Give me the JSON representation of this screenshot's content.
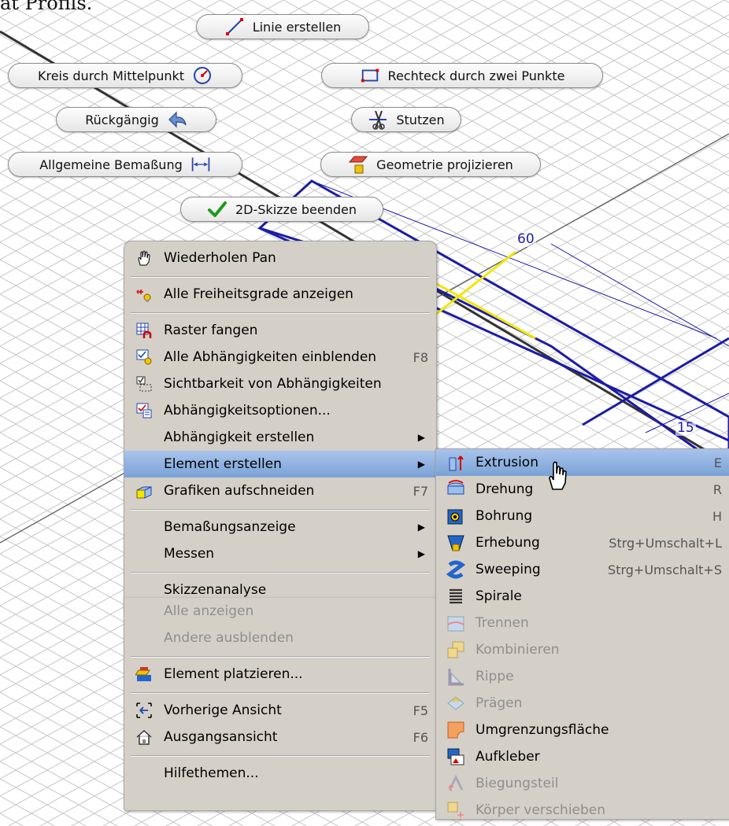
{
  "caption": "at Profils.",
  "dimensions": {
    "top": "60",
    "side": "15"
  },
  "marking_buttons": {
    "line": "Linie erstellen",
    "circle": "Kreis durch Mittelpunkt",
    "rectangle": "Rechteck durch zwei Punkte",
    "undo": "Rückgängig",
    "trim": "Stutzen",
    "dimension": "Allgemeine Bemaßung",
    "project": "Geometrie projizieren",
    "finish": "2D-Skizze beenden"
  },
  "context_menu": {
    "items": [
      {
        "label": "Wiederholen Pan",
        "shortcut": ""
      },
      {
        "label": "Alle Freiheitsgrade anzeigen",
        "shortcut": ""
      },
      {
        "label": "Raster fangen",
        "shortcut": ""
      },
      {
        "label": "Alle Abhängigkeiten einblenden",
        "shortcut": "F8"
      },
      {
        "label": "Sichtbarkeit von Abhängigkeiten",
        "shortcut": ""
      },
      {
        "label": "Abhängigkeitsoptionen...",
        "shortcut": ""
      },
      {
        "label": "Abhängigkeit erstellen",
        "shortcut": ""
      },
      {
        "label": "Element erstellen",
        "shortcut": ""
      },
      {
        "label": "Grafiken aufschneiden",
        "shortcut": "F7"
      },
      {
        "label": "Bemaßungsanzeige",
        "shortcut": ""
      },
      {
        "label": "Messen",
        "shortcut": ""
      },
      {
        "label": "Skizzenanalyse",
        "shortcut": ""
      },
      {
        "label": "Alle anzeigen",
        "shortcut": ""
      },
      {
        "label": "Andere ausblenden",
        "shortcut": ""
      },
      {
        "label": "Element platzieren...",
        "shortcut": ""
      },
      {
        "label": "Vorherige Ansicht",
        "shortcut": "F5"
      },
      {
        "label": "Ausgangsansicht",
        "shortcut": "F6"
      },
      {
        "label": "Hilfethemen...",
        "shortcut": ""
      }
    ]
  },
  "submenu": {
    "items": [
      {
        "label": "Extrusion",
        "shortcut": "E"
      },
      {
        "label": "Drehung",
        "shortcut": "R"
      },
      {
        "label": "Bohrung",
        "shortcut": "H"
      },
      {
        "label": "Erhebung",
        "shortcut": "Strg+Umschalt+L"
      },
      {
        "label": "Sweeping",
        "shortcut": "Strg+Umschalt+S"
      },
      {
        "label": "Spirale",
        "shortcut": ""
      },
      {
        "label": "Trennen",
        "shortcut": ""
      },
      {
        "label": "Kombinieren",
        "shortcut": ""
      },
      {
        "label": "Rippe",
        "shortcut": ""
      },
      {
        "label": "Prägen",
        "shortcut": ""
      },
      {
        "label": "Umgrenzungsfläche",
        "shortcut": ""
      },
      {
        "label": "Aufkleber",
        "shortcut": ""
      },
      {
        "label": "Biegungsteil",
        "shortcut": ""
      },
      {
        "label": "Körper verschieben",
        "shortcut": ""
      }
    ]
  },
  "colors": {
    "highlight": "#8fb0e0",
    "menu_bg": "#d4d0c8",
    "sketch_blue": "#1c1ca8",
    "sketch_yellow": "#f2e600"
  },
  "icons": [
    "hand-pan-icon",
    "pointer-hand-icon",
    "check-icon"
  ]
}
